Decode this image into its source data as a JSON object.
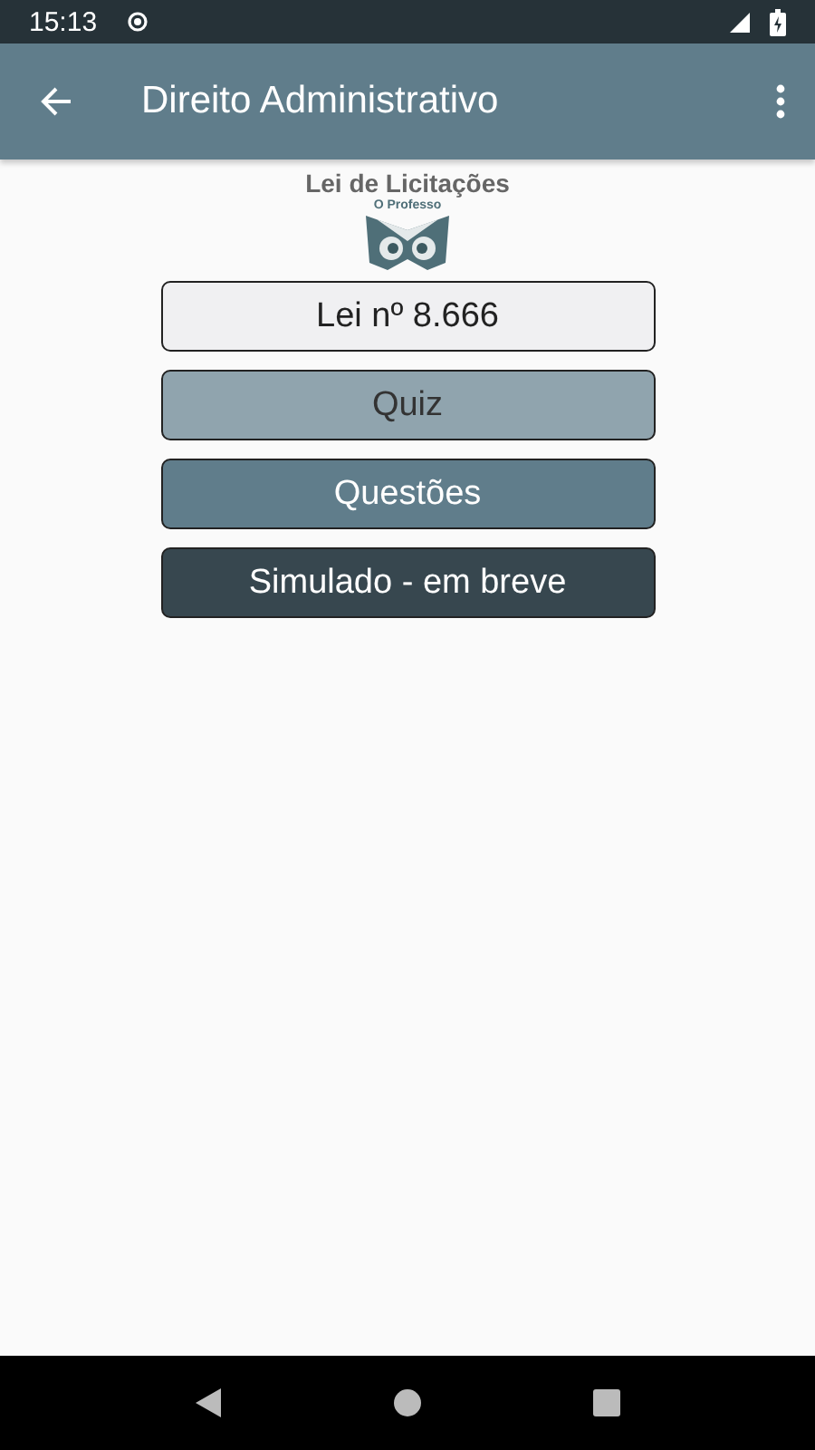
{
  "status_bar": {
    "time": "15:13"
  },
  "app_bar": {
    "title": "Direito Administrativo"
  },
  "heading": "Lei de Licitações",
  "logo": {
    "text": "O Professo"
  },
  "buttons": [
    {
      "label": "Lei nº 8.666",
      "kind": "light"
    },
    {
      "label": "Quiz",
      "kind": "muted"
    },
    {
      "label": "Questões",
      "kind": "medium"
    },
    {
      "label": "Simulado - em breve",
      "kind": "dark"
    }
  ]
}
